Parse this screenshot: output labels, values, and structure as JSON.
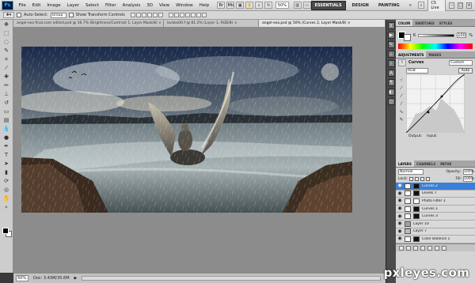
{
  "menubar": {
    "logo": "Ps",
    "items": [
      "File",
      "Edit",
      "Image",
      "Layer",
      "Select",
      "Filter",
      "Analysis",
      "3D",
      "View",
      "Window",
      "Help"
    ],
    "zoom": "50%",
    "workspaces": [
      "ESSENTIALS",
      "DESIGN",
      "PAINTING"
    ],
    "more": "»",
    "cs_live": "CS Live"
  },
  "options": {
    "auto_select_label": "Auto-Select:",
    "auto_select_value": "Group",
    "show_transform_label": "Show Transform Controls"
  },
  "tabs": [
    "angel-sea final.com edited.psd @ 16.7% (Brightness/Contrast 1, Layer Mask/8) ×",
    "lockko00.f @ 81.2% (Layer 1, RGB/8) ×",
    "angel-sea.psd @ 50% (Curves 2, Layer Mask/8) ×"
  ],
  "status": {
    "zoom": "50%",
    "doc": "Doc: 3.43M/35.6M"
  },
  "color_panel": {
    "tabs": [
      "COLOR",
      "SWATCHES",
      "STYLES"
    ],
    "k_label": "K",
    "k_value": "100",
    "percent": "%"
  },
  "adjustments": {
    "tabs": [
      "ADJUSTMENTS",
      "MASKS"
    ],
    "title": "Curves",
    "preset": "Custom",
    "channel": "RGB",
    "auto": "Auto",
    "output": "Output:",
    "input": "Input:"
  },
  "layers": {
    "tabs": [
      "LAYERS",
      "CHANNELS",
      "PATHS"
    ],
    "blend_mode": "Normal",
    "opacity_label": "Opacity:",
    "opacity": "100%",
    "lock_label": "Lock:",
    "fill_label": "Fill:",
    "fill": "100%",
    "rows": [
      {
        "name": "Curves 2"
      },
      {
        "name": "Levels 7"
      },
      {
        "name": "Photo Filter 1"
      },
      {
        "name": "Curves 1"
      },
      {
        "name": "Curves 3"
      },
      {
        "name": "Layer 10"
      },
      {
        "name": "Layer 7"
      },
      {
        "name": "Color Balance 1"
      }
    ]
  },
  "watermark": "pxleyes.com"
}
